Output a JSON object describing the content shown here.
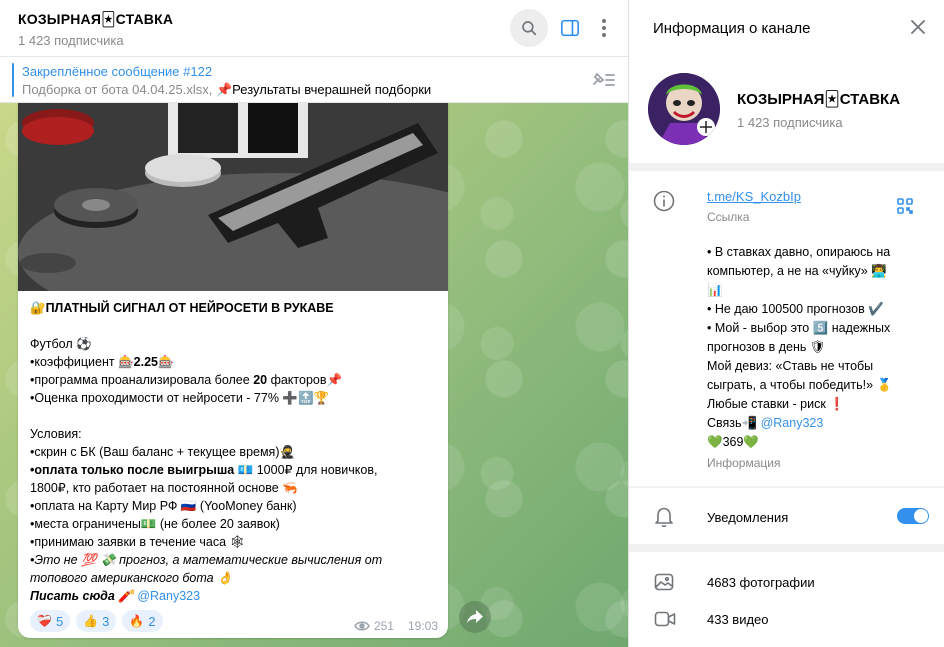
{
  "header": {
    "title": "КОЗЫРНАЯ🃏СТАВКА",
    "subscribers": "1 423 подписчика"
  },
  "pinned": {
    "title": "Закреплённое сообщение #122",
    "text_gray": "Подборка от бота 04.04.25.xlsx, ",
    "text_rest": "📌Результаты вчерашней подборки"
  },
  "message": {
    "heading": "🔐ПЛАТНЫЙ СИГНАЛ ОТ НЕЙРОСЕТИ В РУКАВЕ",
    "sport": "Футбол ⚽",
    "line_coef_pre": "•коэффициент 🎰",
    "line_coef_val": "2.25",
    "line_coef_post": "🎰",
    "line_factors_pre": "•программа проанализировала более ",
    "line_factors_val": "20",
    "line_factors_post": " факторов📌",
    "line_rating": "•Оценка проходимости от нейросети - 77% ➕🔝🏆",
    "conditions": "Условия:",
    "cond1": "•скрин с БК (Ваш баланс + текущее время)🥷",
    "cond2_bold": "•оплата только после выигрыша",
    "cond2_rest": " 💶 1000₽ для новичков,",
    "cond2_line2": "1800₽, кто работает на постоянной основе 🦐",
    "cond3": "•оплата на Карту Мир РФ 🇷🇺 (YooMoney банк)",
    "cond4": "•места ограничены💵 (не более 20 заявок)",
    "cond5": "•принимаю заявки в течение часа 🕸",
    "note_line1": "•Это не 💯 💸 прогноз, а математические вычисления от",
    "note_line2": "топового американского бота 👌",
    "write_label": "Писать сюда 🧨 ",
    "write_link": "@Rany323",
    "reactions": [
      {
        "emoji": "❤️‍🩹",
        "count": "5"
      },
      {
        "emoji": "👍",
        "count": "3"
      },
      {
        "emoji": "🔥",
        "count": "2"
      }
    ],
    "views": "251",
    "time": "19:03"
  },
  "info": {
    "title": "Информация о канале",
    "name": "КОЗЫРНАЯ🃏СТАВКА",
    "subscribers": "1 423 подписчика",
    "link": "t.me/KS_KozbIp",
    "link_label": "Ссылка",
    "desc_lines": [
      "• В ставках давно, опираюсь на",
      "компьютер, а не на «чуйку» 👨‍💻",
      "📊",
      "• Не даю 100500 прогнозов ✔️",
      "• Мой - выбор это 5️⃣ надежных",
      "прогнозов в день 🛡",
      "Мой девиз: «Ставь не чтобы",
      "сыграть, а чтобы победить!» 🥇",
      "Любые ставки - риск ❗",
      "Связь📲 ",
      "💚369💚"
    ],
    "contact_link": "@Rany323",
    "desc_label": "Информация",
    "notifications": "Уведомления",
    "photos": "4683 фотографии",
    "videos": "433 видео"
  },
  "colors": {
    "accent": "#3390ec",
    "muted": "#8a8a8a"
  }
}
